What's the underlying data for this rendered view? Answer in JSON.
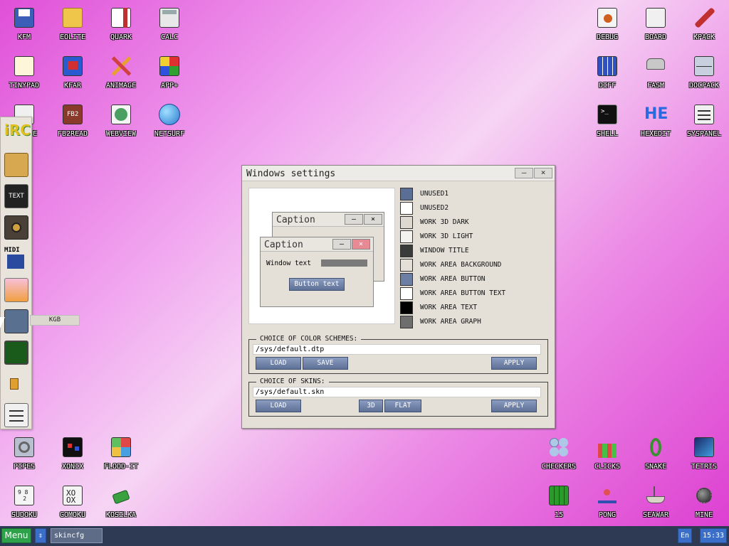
{
  "desktop_icons": [
    {
      "label": "KFM",
      "icon": "floppy-icon"
    },
    {
      "label": "EOLITE",
      "icon": "folder-icon"
    },
    {
      "label": "QUARK",
      "icon": "book-icon"
    },
    {
      "label": "CALC",
      "icon": "calculator-icon"
    },
    {
      "label": "TINYPAD",
      "icon": "notepad-icon"
    },
    {
      "label": "KFAR",
      "icon": "archive-icon"
    },
    {
      "label": "ANIMAGE",
      "icon": "pencil-ruler-icon"
    },
    {
      "label": "APP+",
      "icon": "cube-icon"
    },
    {
      "label": "E",
      "icon": "text-editor-icon"
    },
    {
      "label": "FB2READ",
      "icon": "fb2-book-icon"
    },
    {
      "label": "WEBVIEW",
      "icon": "webview-icon"
    },
    {
      "label": "NETSURF",
      "icon": "globe-icon"
    },
    {
      "label": "DEBUG",
      "icon": "debug-bug-icon"
    },
    {
      "label": "BOARD",
      "icon": "board-icon"
    },
    {
      "label": "KPACK",
      "icon": "wrench-icon"
    },
    {
      "label": "DIFF",
      "icon": "diff-icon"
    },
    {
      "label": "FASM",
      "icon": "fasm-icon"
    },
    {
      "label": "DOCPACK",
      "icon": "cabinet-icon"
    },
    {
      "label": "SHELL",
      "icon": "terminal-icon"
    },
    {
      "label": "HEXEDIT",
      "icon": "hex-editor-icon"
    },
    {
      "label": "SYSPANEL",
      "icon": "sliders-icon"
    },
    {
      "label": "PIPES",
      "icon": "pipes-icon"
    },
    {
      "label": "XONIX",
      "icon": "xonix-icon"
    },
    {
      "label": "FLOOD-IT",
      "icon": "flood-grid-icon"
    },
    {
      "label": "SUDOKU",
      "icon": "sudoku-icon"
    },
    {
      "label": "GOMOKU",
      "icon": "gomoku-icon"
    },
    {
      "label": "KOSILKA",
      "icon": "lawnmower-icon"
    },
    {
      "label": "CHECKERS",
      "icon": "checkers-icon"
    },
    {
      "label": "CLICKS",
      "icon": "clicks-blocks-icon"
    },
    {
      "label": "SNAKE",
      "icon": "snake-icon"
    },
    {
      "label": "TETRIS",
      "icon": "tetris-icon"
    },
    {
      "label": "15",
      "icon": "fifteen-grid-icon"
    },
    {
      "label": "PONG",
      "icon": "pong-icon"
    },
    {
      "label": "SEAWAR",
      "icon": "ship-icon"
    },
    {
      "label": "MINE",
      "icon": "mine-icon"
    }
  ],
  "dock": {
    "items": [
      "irc-icon",
      "package-icon",
      "text-icon",
      "speaker-icon",
      "midi-play-icon",
      "image-viewer-icon",
      "kgb-icon",
      "cpu-chip-icon",
      "volume-icon",
      "settings-sliders-icon"
    ],
    "tooltip": "KGB"
  },
  "window": {
    "title": "Windows settings",
    "minimize": "–",
    "close": "×",
    "preview": {
      "back_caption": "Caption",
      "front_caption": "Caption",
      "window_text": "Window text",
      "button_text": "Button text"
    },
    "colors": [
      {
        "name": "UNUSED1",
        "color": "#5a6e96"
      },
      {
        "name": "UNUSED2",
        "color": "#ffffff"
      },
      {
        "name": "WORK 3D DARK",
        "color": "#ddd8d0"
      },
      {
        "name": "WORK 3D LIGHT",
        "color": "#f4f2ee"
      },
      {
        "name": "WINDOW TITLE",
        "color": "#3a3a3a"
      },
      {
        "name": "WORK AREA BACKGROUND",
        "color": "#e4e0d8"
      },
      {
        "name": "WORK AREA BUTTON",
        "color": "#6d7ea4"
      },
      {
        "name": "WORK AREA BUTTON TEXT",
        "color": "#ffffff"
      },
      {
        "name": "WORK AREA TEXT",
        "color": "#000000"
      },
      {
        "name": "WORK AREA GRAPH",
        "color": "#6e6e6e"
      }
    ],
    "schemes": {
      "label": "CHOICE OF COLOR SCHEMES:",
      "path": "/sys/default.dtp",
      "load": "LOAD",
      "save": "SAVE",
      "apply": "APPLY"
    },
    "skins": {
      "label": "CHOICE OF SKINS:",
      "path": "/sys/default.skn",
      "load": "LOAD",
      "mode_3d": "3D",
      "mode_flat": "FLAT",
      "apply": "APPLY"
    }
  },
  "taskbar": {
    "menu": "Menu",
    "switch": "⇕",
    "active_task": "skincfg",
    "lang": "En",
    "clock": "15:33"
  }
}
